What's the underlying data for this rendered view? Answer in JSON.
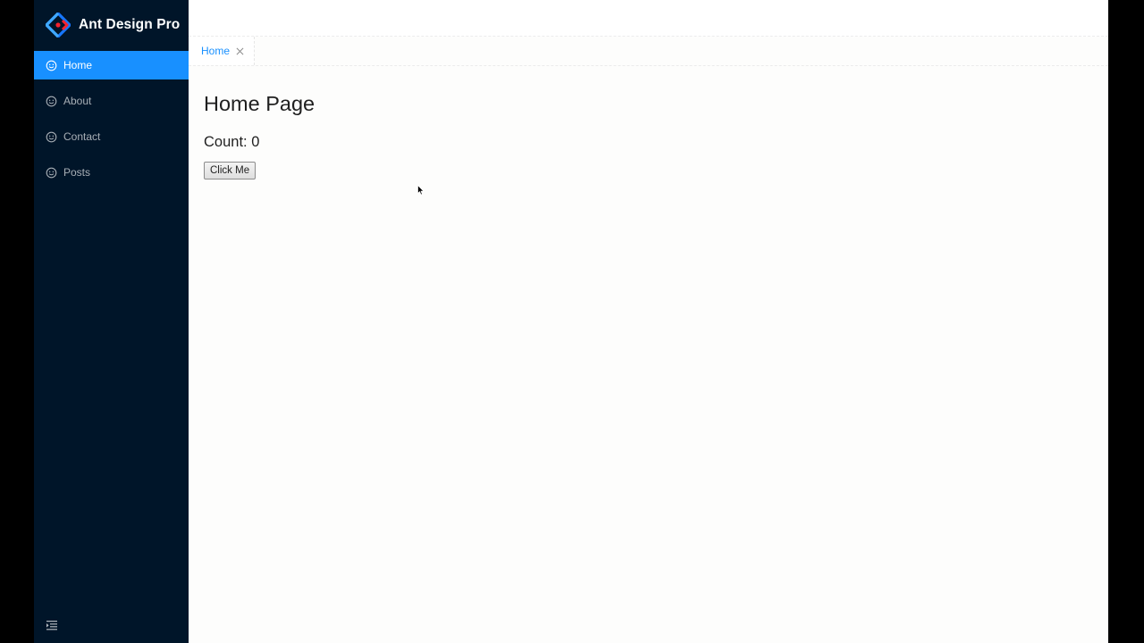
{
  "app": {
    "title": "Ant Design Pro"
  },
  "sidebar": {
    "items": [
      {
        "label": "Home",
        "icon": "smile-icon",
        "active": true
      },
      {
        "label": "About",
        "icon": "smile-icon",
        "active": false
      },
      {
        "label": "Contact",
        "icon": "smile-icon",
        "active": false
      },
      {
        "label": "Posts",
        "icon": "smile-icon",
        "active": false
      }
    ],
    "collapse_icon": "menu-fold-icon"
  },
  "tabs": [
    {
      "label": "Home",
      "active": true
    }
  ],
  "page": {
    "title": "Home Page",
    "count_label": "Count:",
    "count_value": "0",
    "button_label": "Click Me"
  },
  "colors": {
    "sider_bg": "#001529",
    "primary": "#1890ff"
  }
}
